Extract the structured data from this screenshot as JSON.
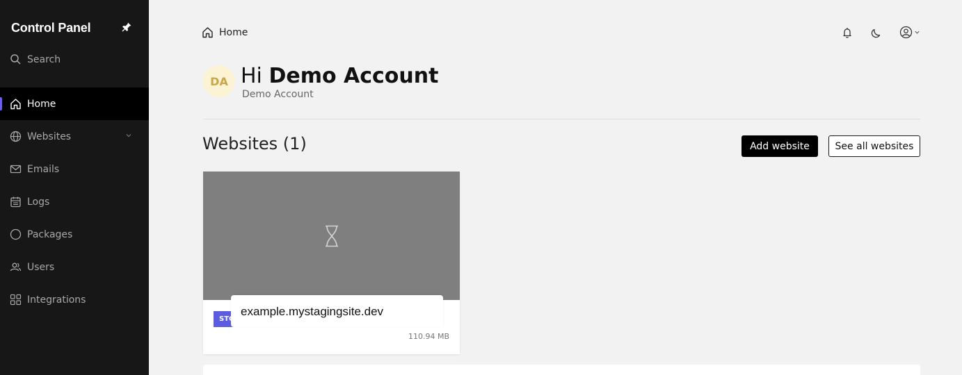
{
  "sidebar": {
    "brand": "Control Panel",
    "search_label": "Search",
    "items": [
      {
        "label": "Home",
        "icon": "home-icon",
        "active": true
      },
      {
        "label": "Websites",
        "icon": "globe-icon",
        "expandable": true
      },
      {
        "label": "Emails",
        "icon": "mail-icon"
      },
      {
        "label": "Logs",
        "icon": "calendar-icon"
      },
      {
        "label": "Packages",
        "icon": "circle-icon"
      },
      {
        "label": "Users",
        "icon": "users-icon"
      },
      {
        "label": "Integrations",
        "icon": "grid-icon"
      }
    ]
  },
  "header": {
    "breadcrumb": "Home",
    "icons": [
      "bell-icon",
      "moon-icon",
      "user-circle-icon"
    ]
  },
  "greeting": {
    "avatar_initials": "DA",
    "hi": "Hi",
    "name": "Demo Account",
    "subtitle": "Demo Account"
  },
  "websites": {
    "title": "Websites (1)",
    "add_label": "Add website",
    "see_all_label": "See all websites",
    "cards": [
      {
        "domain": "example.mystagingsite.dev",
        "env_badge": "STG",
        "size": "110.94 MB"
      }
    ]
  },
  "colors": {
    "sidebar_bg": "#171717",
    "accent": "#6b5cff",
    "badge": "#5b5ce2",
    "avatar_bg": "#fbf3d3"
  }
}
